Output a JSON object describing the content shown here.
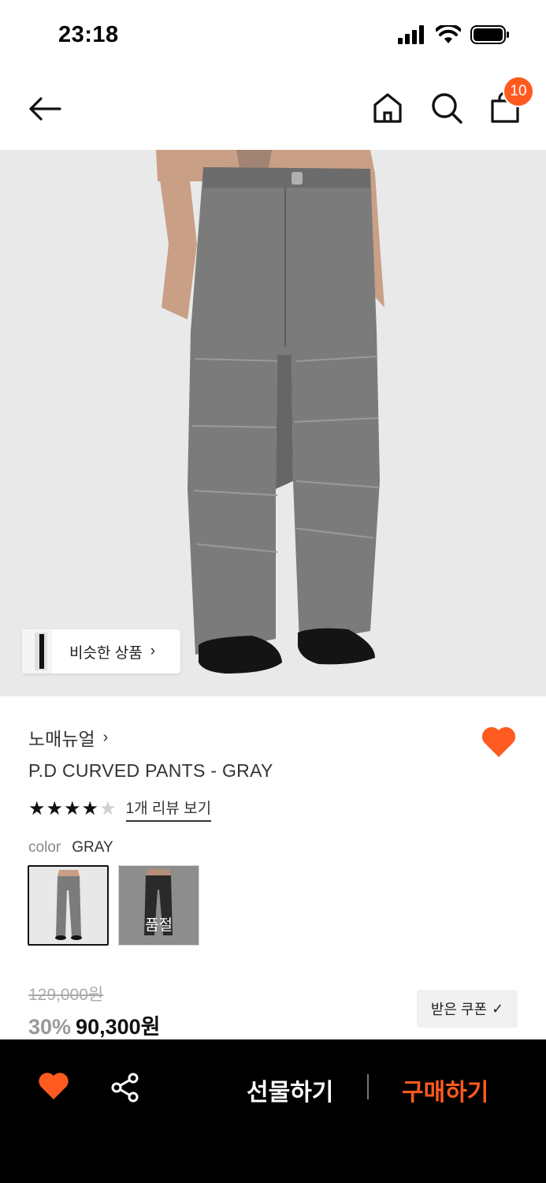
{
  "status_bar": {
    "time": "23:18",
    "icons": [
      "signal-icon",
      "wifi-icon",
      "battery-icon"
    ]
  },
  "nav": {
    "icons": [
      "back-arrow-icon",
      "home-icon",
      "search-icon",
      "shopping-bag-icon"
    ],
    "cart_count": "10"
  },
  "hero": {
    "image_subject": "gray wide-leg pants worn by model with black shoes",
    "similar_label": "비슷한 상품",
    "similar_arrow": "›"
  },
  "product": {
    "brand": "노매뉴얼",
    "brand_arrow": "›",
    "name": "P.D CURVED PANTS - GRAY",
    "rating": 4,
    "rating_max": 5,
    "review_link": "1개 리뷰 보기",
    "color_key": "color",
    "color_value": "GRAY",
    "swatches": [
      {
        "color": "GRAY",
        "selected": true,
        "soldout_label": ""
      },
      {
        "color": "BLACK",
        "selected": false,
        "soldout_label": "품절"
      }
    ],
    "original_price": "129,000원",
    "discount": "30%",
    "sale_price": "90,300원",
    "coupon_label": "받은 쿠폰",
    "coupon_check": "✓"
  },
  "bottom_bar": {
    "gift_label": "선물하기",
    "buy_label": "구매하기"
  },
  "colors": {
    "accent": "#ff5a1f",
    "bottom_bar_bg": "#000000",
    "hero_bg": "#e9e9e9"
  }
}
